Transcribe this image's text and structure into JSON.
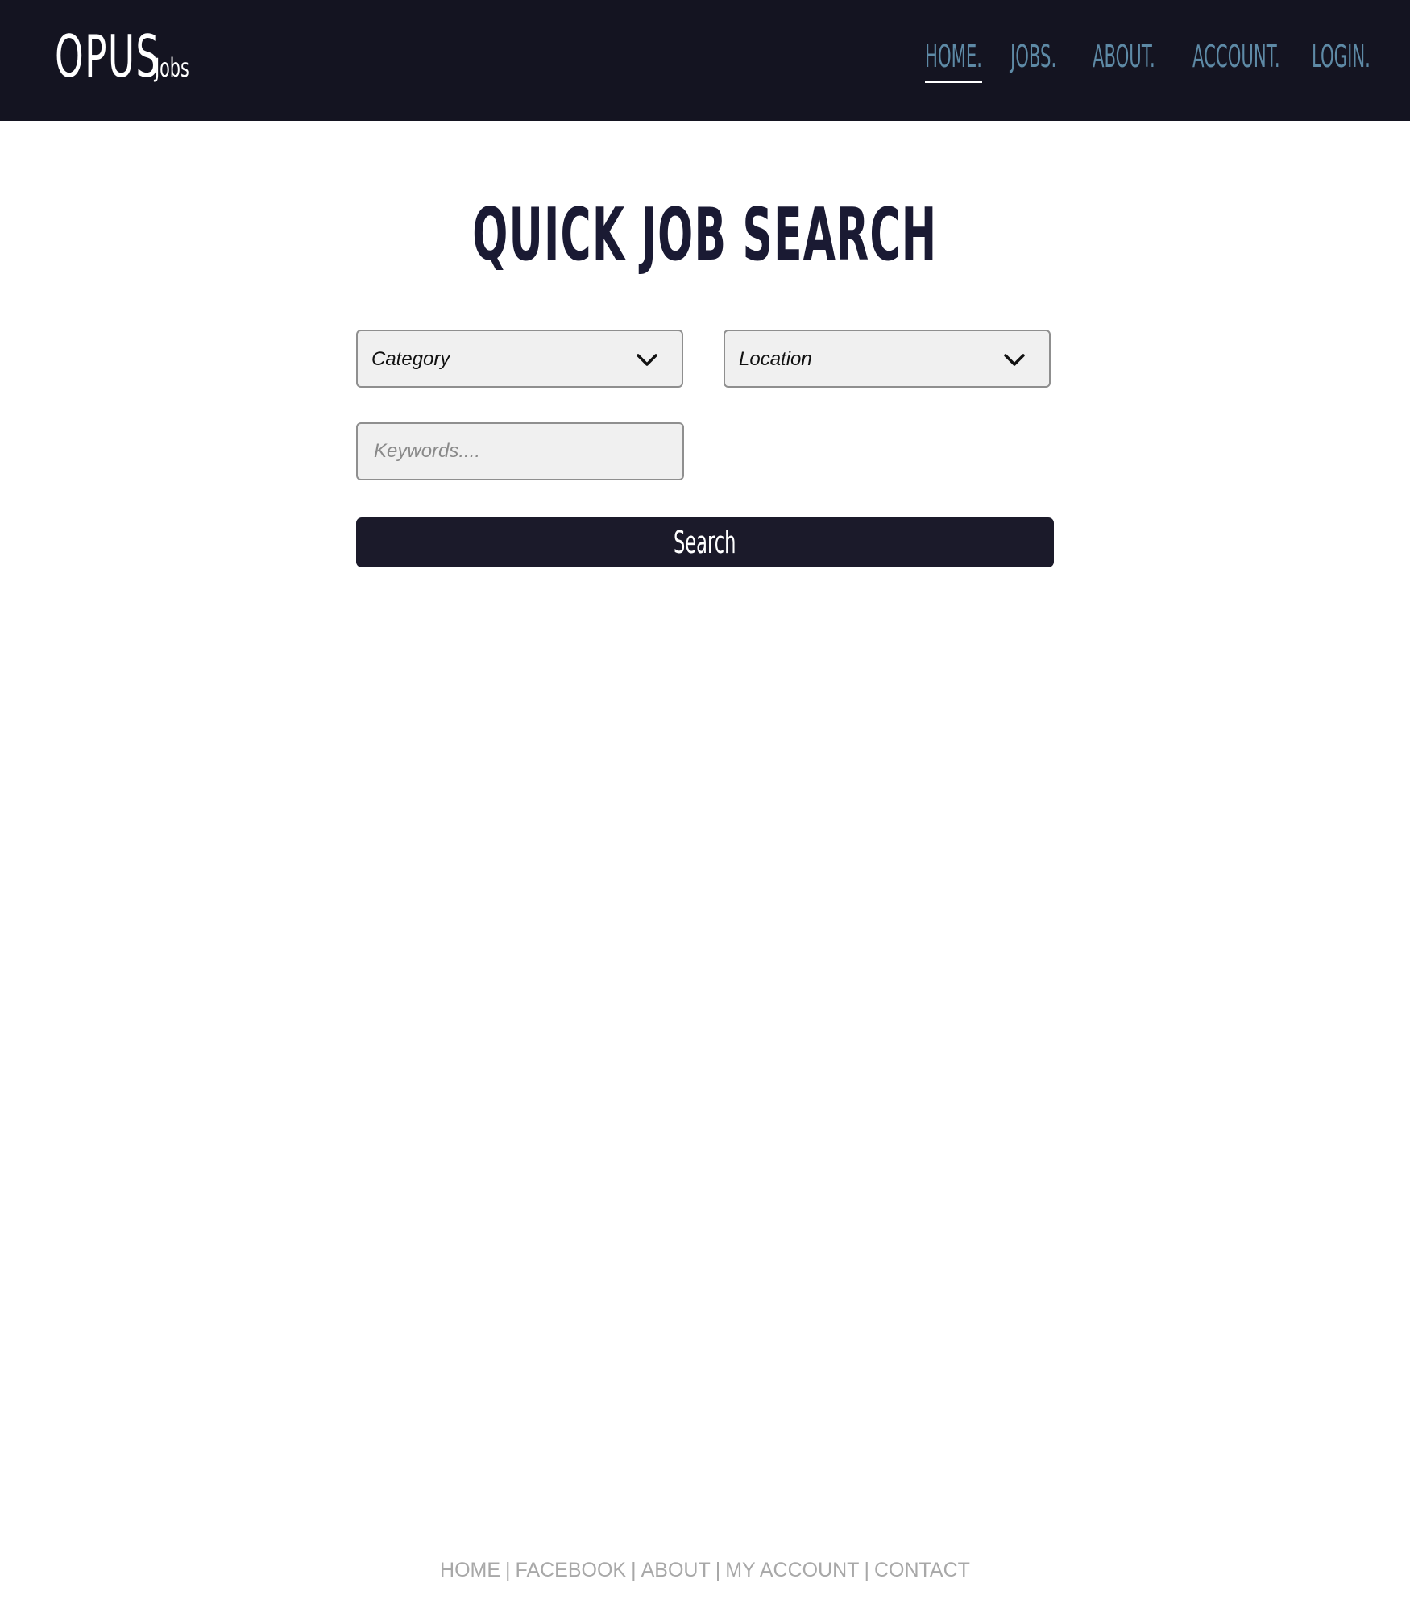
{
  "header": {
    "logo": {
      "main": "OPUS",
      "sub": "Jobs"
    },
    "nav": [
      {
        "label": "HOME.",
        "active": true
      },
      {
        "label": "JOBS.",
        "active": false
      },
      {
        "label": "ABOUT.",
        "active": false
      },
      {
        "label": "ACCOUNT.",
        "active": false
      },
      {
        "label": "LOGIN.",
        "active": false
      }
    ]
  },
  "main": {
    "title": "QUICK JOB SEARCH",
    "category_select": {
      "label": "Category"
    },
    "location_select": {
      "label": "Location"
    },
    "keywords": {
      "placeholder": "Keywords....",
      "value": ""
    },
    "search_button": "Search"
  },
  "footer": {
    "links": [
      "HOME",
      "FACEBOOK",
      "ABOUT",
      "MY ACCOUNT",
      "CONTACT"
    ],
    "separator": "|"
  },
  "colors": {
    "header_bg": "#141421",
    "nav_link": "#5e8aa6",
    "title": "#1a1a33",
    "button_bg": "#1b1a2a",
    "footer_text": "#a8a8a8"
  },
  "icons": {
    "select_arrow": "chevron-down-icon"
  }
}
